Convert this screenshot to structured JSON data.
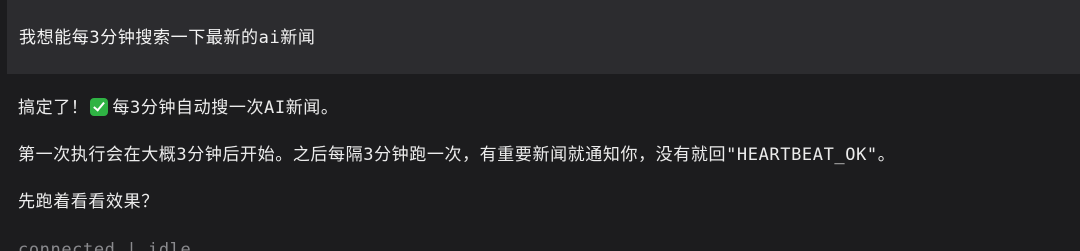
{
  "user_message": {
    "text": "我想能每3分钟搜索一下最新的ai新闻"
  },
  "assistant_reply": {
    "line1_before_icon": "搞定了！",
    "line1_icon": "check-mark-icon",
    "line1_after_icon": "每3分钟自动搜一次AI新闻。",
    "paragraph2": "第一次执行会在大概3分钟后开始。之后每隔3分钟跑一次，有重要新闻就通知你，没有就回\"HEARTBEAT_OK\"。",
    "paragraph3": "先跑着看看效果？"
  },
  "status": {
    "text": "connected | idle"
  },
  "colors": {
    "background": "#1c1c1e",
    "user_bubble": "#2c2c2f",
    "check_icon": "#2fb344",
    "status_text": "#8a8a8e"
  }
}
